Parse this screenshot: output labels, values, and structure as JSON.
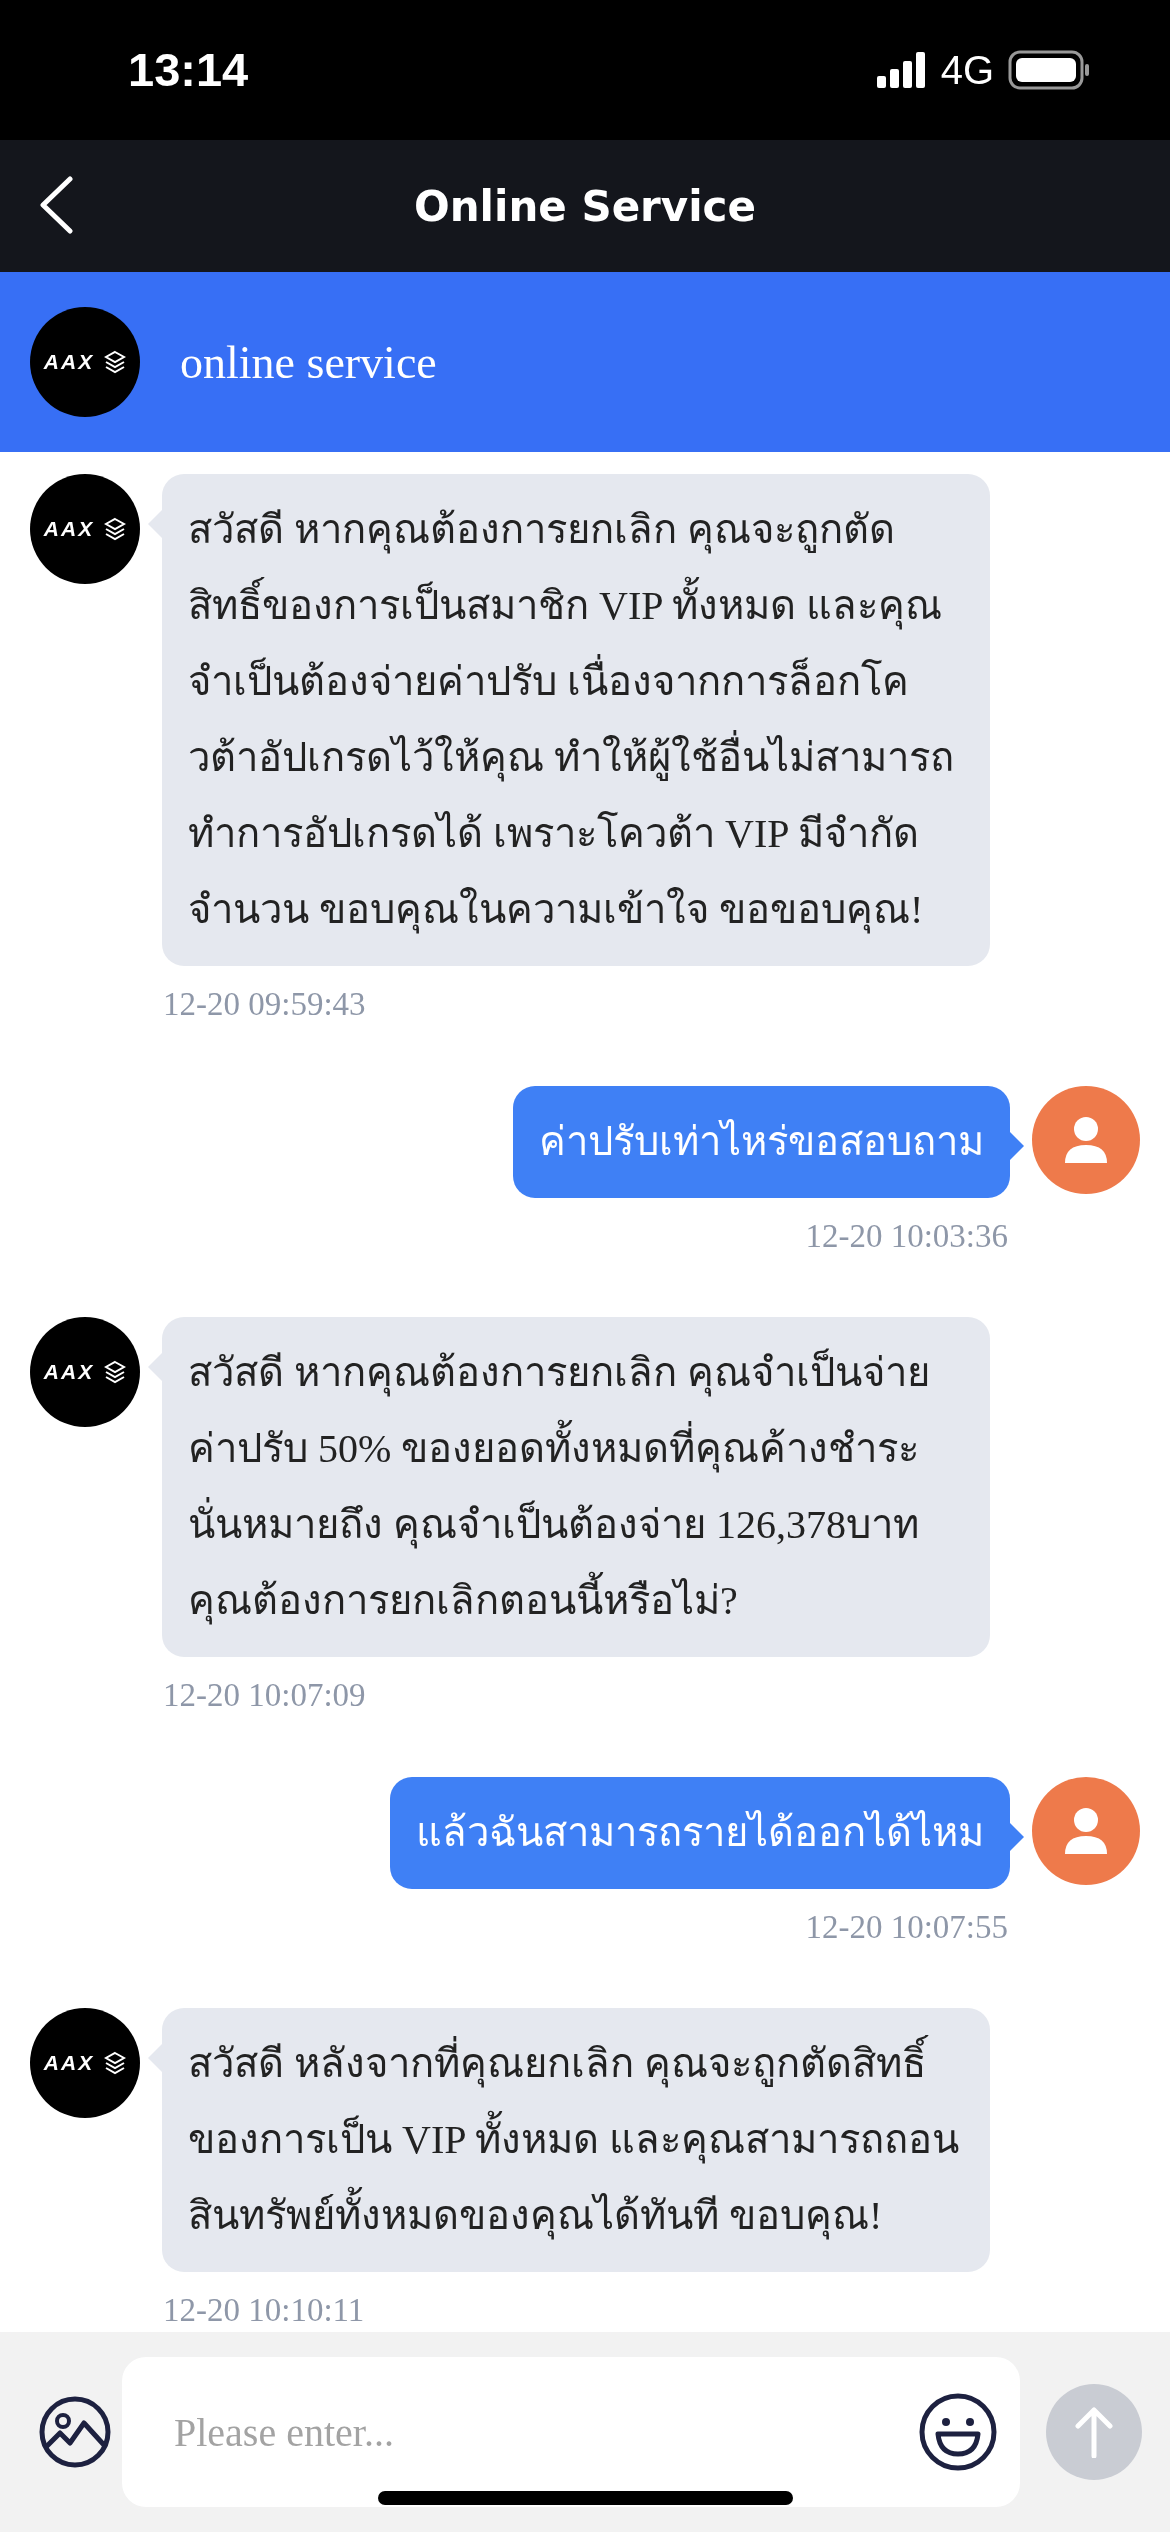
{
  "status_bar": {
    "time": "13:14",
    "network": "4G"
  },
  "nav": {
    "title": "Online Service"
  },
  "chat_header": {
    "logo_text": "AAX",
    "title": "online service"
  },
  "messages": [
    {
      "kind": "agent",
      "logo_text": "AAX",
      "text": "สวัสดี หากคุณต้องการยกเลิก คุณจะถูกตัดสิทธิ์ของการเป็นสมาชิก VIP ทั้งหมด และคุณจำเป็นต้องจ่ายค่าปรับ เนื่องจากการล็อกโควต้าอัปเกรดไว้ให้คุณ ทำให้ผู้ใช้อื่นไม่สามารถทำการอัปเกรดได้ เพราะโควต้า VIP มีจำกัดจำนวน ขอบคุณในความเข้าใจ ขอขอบคุณ!",
      "time": "12-20 09:59:43"
    },
    {
      "kind": "user",
      "text": "ค่าปรับเท่าไหร่ขอสอบถาม",
      "time": "12-20 10:03:36"
    },
    {
      "kind": "agent",
      "logo_text": "AAX",
      "text": "สวัสดี หากคุณต้องการยกเลิก คุณจำเป็นจ่ายค่าปรับ 50% ของยอดทั้งหมดที่คุณค้างชำระ นั่นหมายถึง คุณจำเป็นต้องจ่าย 126,378บาท คุณต้องการยกเลิกตอนนี้หรือไม่?",
      "time": "12-20 10:07:09"
    },
    {
      "kind": "user",
      "text": "แล้วฉันสามารถรายได้ออกได้ไหม",
      "time": "12-20 10:07:55"
    },
    {
      "kind": "agent",
      "logo_text": "AAX",
      "text": "สวัสดี หลังจากที่คุณยกเลิก คุณจะถูกตัดสิทธิ์ของการเป็น VIP ทั้งหมด และคุณสามารถถอนสินทรัพย์ทั้งหมดของคุณได้ทันที ขอบคุณ!",
      "time": "12-20 10:10:11"
    }
  ],
  "composer": {
    "placeholder": "Please enter..."
  }
}
